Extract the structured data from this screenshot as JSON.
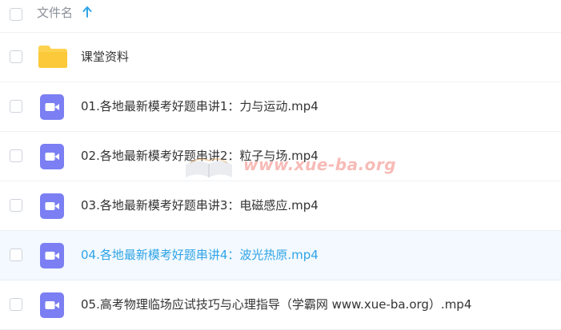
{
  "header": {
    "name_label": "文件名",
    "sort_icon": "arrow-up-icon",
    "sort_direction": "ascending"
  },
  "files": [
    {
      "name": "课堂资料",
      "type": "folder",
      "icon": "folder-icon"
    },
    {
      "name": "01.各地最新模考好题串讲1：力与运动.mp4",
      "type": "video",
      "icon": "video-file-icon"
    },
    {
      "name": "02.各地最新模考好题串讲2：粒子与场.mp4",
      "type": "video",
      "icon": "video-file-icon"
    },
    {
      "name": "03.各地最新模考好题串讲3：电磁感应.mp4",
      "type": "video",
      "icon": "video-file-icon"
    },
    {
      "name": "04.各地最新模考好题串讲4：波光热原.mp4",
      "type": "video",
      "icon": "video-file-icon",
      "hovered": true
    },
    {
      "name": "05.高考物理临场应试技巧与心理指导（学霸网 www.xue-ba.org）.mp4",
      "type": "video",
      "icon": "video-file-icon"
    }
  ],
  "watermark": {
    "text": "www.xue-ba.org",
    "icon": "book-logo-icon"
  },
  "colors": {
    "folder": "#fcd24f",
    "video_icon": "#7b7ff3",
    "hover_text": "#2fa4e7",
    "hover_row": "#f3f9fe",
    "text": "#333333",
    "header_text": "#8a8f99",
    "sort_arrow": "#2fa4e7",
    "watermark": "#ee6860"
  }
}
